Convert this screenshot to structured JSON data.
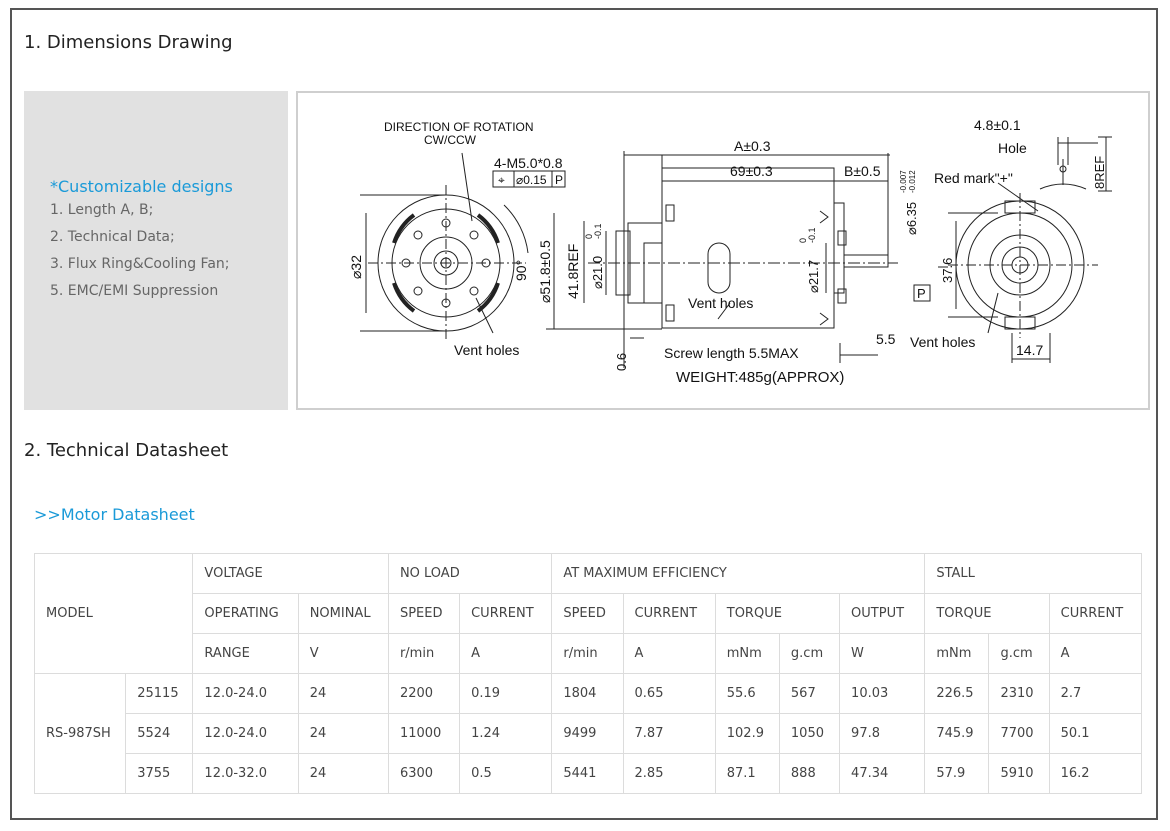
{
  "section1": {
    "title": "1. Dimensions Drawing"
  },
  "section2": {
    "title": "2. Technical Datasheet"
  },
  "promo": {
    "title": "*Customizable designs",
    "items": [
      "1. Length A, B;",
      "2. Technical Data;",
      "3. Flux Ring&Cooling Fan;",
      "5. EMC/EMI Suppression"
    ]
  },
  "drawing": {
    "rotation_1": "DIRECTION OF ROTATION",
    "rotation_2": "CW/CCW",
    "screws": "4-M5.0*0.8",
    "tol_symbol": "⌖",
    "tol_value": "⌀0.15",
    "tol_ref": "P",
    "dia32": "⌀32",
    "angle": "90°",
    "dia51": "⌀51.8±0.5",
    "ref41": "41.8REF",
    "dia21": "⌀21.0",
    "dia21_sup": "0",
    "dia21_sub": "-0.1",
    "dim_a": "A±0.3",
    "dim_69": "69±0.3",
    "dim_b": "B±0.5",
    "dia635": "⌀6.35",
    "dia635_sup": "-0.007",
    "dia635_sub": "-0.012",
    "dia217": "⌀21.7",
    "dia217_sup": "0",
    "dia217_sub": "-0.1",
    "vent_holes": "Vent holes",
    "dim_06": "0.6",
    "screw_length": "Screw length 5.5MAX",
    "weight": "WEIGHT:485g(APPROX)",
    "dim_55": "5.5",
    "dim_48": "4.8±0.1",
    "hole": "Hole",
    "ref8": "8REF",
    "red_mark": "Red mark\"+\"",
    "dim_376": "37.6",
    "datum_p": "P",
    "dim_147": "14.7"
  },
  "datasheet_link": ">>Motor Datasheet",
  "table": {
    "model_header": "MODEL",
    "voltage": "VOLTAGE",
    "no_load": "NO LOAD",
    "at_max": "AT MAXIMUM EFFICIENCY",
    "stall": "STALL",
    "operating": "OPERATING",
    "nominal": "NOMINAL",
    "speed": "SPEED",
    "current": "CURRENT",
    "torque": "TORQUE",
    "output": "OUTPUT",
    "range": "RANGE",
    "u_v": "V",
    "u_rmin": "r/min",
    "u_a": "A",
    "u_mnm": "mNm",
    "u_gcm": "g.cm",
    "u_w": "W",
    "model": "RS-987SH",
    "rows": [
      [
        "25115",
        "12.0-24.0",
        "24",
        "2200",
        "0.19",
        "1804",
        "0.65",
        "55.6",
        "567",
        "10.03",
        "226.5",
        "2310",
        "2.7"
      ],
      [
        "5524",
        "12.0-24.0",
        "24",
        "11000",
        "1.24",
        "9499",
        "7.87",
        "102.9",
        "1050",
        "97.8",
        "745.9",
        "7700",
        "50.1"
      ],
      [
        "3755",
        "12.0-32.0",
        "24",
        "6300",
        "0.5",
        "5441",
        "2.85",
        "87.1",
        "888",
        "47.34",
        "57.9",
        "5910",
        "16.2"
      ]
    ]
  }
}
